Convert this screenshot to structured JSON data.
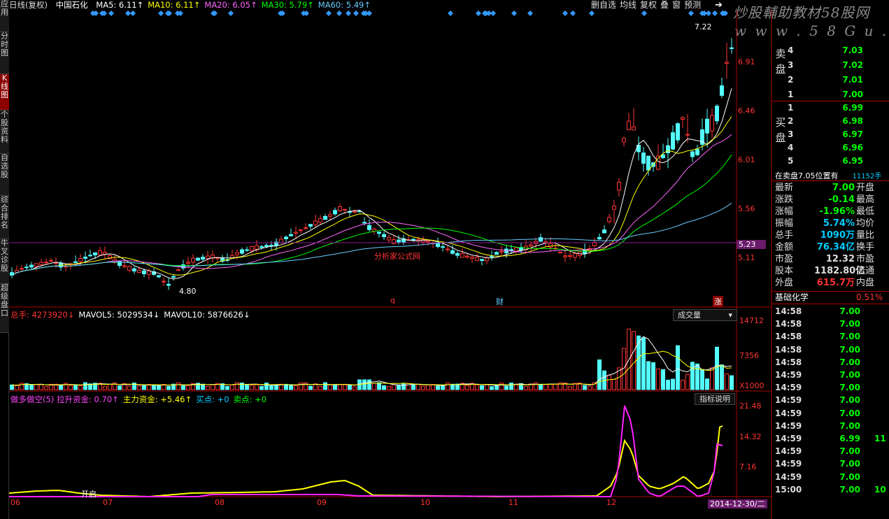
{
  "left_tabs": [
    {
      "label": "应用",
      "active": false
    },
    {
      "label": "分时图",
      "active": false
    },
    {
      "label": "K线图",
      "active": true
    },
    {
      "label": "个股资料",
      "active": false
    },
    {
      "label": "自选股",
      "active": false
    },
    {
      "label": "综合排名",
      "active": false
    },
    {
      "label": "牛叉诊股",
      "active": false
    },
    {
      "label": "超级盘口",
      "active": false
    }
  ],
  "header": {
    "period": "日线(复权)",
    "stock_name": "中国石化",
    "mas": [
      {
        "label": "MA5: 6.11↑",
        "color": "#ffffff"
      },
      {
        "label": "MA10: 6.11↑",
        "color": "#ffff00"
      },
      {
        "label": "MA20: 6.05↑",
        "color": "#ff66ff"
      },
      {
        "label": "MA30: 5.79↑",
        "color": "#00ff00"
      },
      {
        "label": "MA60: 5.49↑",
        "color": "#66ccff"
      }
    ]
  },
  "toolbar": {
    "items": [
      "删自选",
      "均线",
      "复权",
      "叠",
      "窗",
      "预测"
    ]
  },
  "watermark": {
    "line1": "炒股輔助教材58股网",
    "line2": "w w w . 5 8 G u . c o m"
  },
  "price_axis": {
    "labels": [
      "6.91",
      "6.46",
      "6.01",
      "5.56",
      "5.11"
    ],
    "current": "5.23"
  },
  "annotations": {
    "high": "7.22",
    "low": "4.80",
    "formula": "分析家公式网",
    "marker_q": "q",
    "marker_cai": "财",
    "marker_zhang": "涨"
  },
  "volume": {
    "legend": "总手: 4273920↓ MAVOL5: 5029534↓ MAVOL10: 5876626↓",
    "legend_parts": [
      {
        "text": "总手: 4273920↓",
        "color": "#ff3333"
      },
      {
        "text": "MAVOL5: 5029534↓",
        "color": "#ffffff"
      },
      {
        "text": "MAVOL10: 5876626↓",
        "color": "#ffffff"
      }
    ],
    "selector": "成交量",
    "axis": [
      "14712",
      "7356",
      "X1000"
    ]
  },
  "indicator": {
    "legend_parts": [
      {
        "text": "做多做空(5) 拉升资金: 0.70↑",
        "color": "#ff44ff"
      },
      {
        "text": "主力资金: +5.46↑",
        "color": "#ffff00"
      },
      {
        "text": "买点: +0",
        "color": "#00ccff"
      },
      {
        "text": "卖点: +0",
        "color": "#00ff00"
      }
    ],
    "button": "指标说明",
    "axis": [
      "21.48",
      "14.32",
      "7.16"
    ],
    "label_in_plot": "开启"
  },
  "x_axis": {
    "labels": [
      "06",
      "07",
      "08",
      "09",
      "10",
      "11",
      "12"
    ],
    "date_badge": "2014-12-30/二"
  },
  "order_book": {
    "sell_label": "卖盘",
    "buy_label": "买盘",
    "sell": [
      {
        "level": "4",
        "price": "7.03"
      },
      {
        "level": "3",
        "price": "7.02"
      },
      {
        "level": "2",
        "price": "7.01"
      },
      {
        "level": "1",
        "price": "7.00"
      }
    ],
    "buy": [
      {
        "level": "1",
        "price": "6.99"
      },
      {
        "level": "2",
        "price": "6.98"
      },
      {
        "level": "3",
        "price": "6.97"
      },
      {
        "level": "4",
        "price": "6.96"
      },
      {
        "level": "5",
        "price": "6.95"
      }
    ],
    "summary": "在卖盘7.05位置有",
    "summary_vol": "11152手"
  },
  "quote": [
    {
      "label": "最新",
      "value": "7.00",
      "color": "#00ff00",
      "right": "开盘"
    },
    {
      "label": "涨跌",
      "value": "-0.14",
      "color": "#00ff00",
      "right": "最高"
    },
    {
      "label": "涨幅",
      "value": "-1.96%",
      "color": "#00ff00",
      "right": "最低"
    },
    {
      "label": "振幅",
      "value": "5.74%",
      "color": "#00ccff",
      "right": "均价"
    },
    {
      "label": "总手",
      "value": "1090万",
      "color": "#00ccff",
      "right": "量比"
    },
    {
      "label": "金额",
      "value": "76.34亿",
      "color": "#00ccff",
      "right": "换手"
    },
    {
      "label": "市盈",
      "value": "12.32",
      "color": "#dddddd",
      "right": "市盈"
    },
    {
      "label": "股本",
      "value": "1182.80亿",
      "color": "#dddddd",
      "right": "流通"
    },
    {
      "label": "外盘",
      "value": "615.7万",
      "color": "#ff3333",
      "right": "内盘"
    }
  ],
  "sector": {
    "name": "基础化学",
    "change": "0.51%"
  },
  "ticks": [
    {
      "time": "14:58",
      "price": "7.00",
      "vol": ""
    },
    {
      "time": "14:58",
      "price": "7.00",
      "vol": ""
    },
    {
      "time": "14:58",
      "price": "7.00",
      "vol": ""
    },
    {
      "time": "14:58",
      "price": "7.00",
      "vol": ""
    },
    {
      "time": "14:58",
      "price": "7.00",
      "vol": ""
    },
    {
      "time": "14:59",
      "price": "7.00",
      "vol": ""
    },
    {
      "time": "14:59",
      "price": "7.00",
      "vol": ""
    },
    {
      "time": "14:59",
      "price": "7.00",
      "vol": ""
    },
    {
      "time": "14:59",
      "price": "7.00",
      "vol": ""
    },
    {
      "time": "14:59",
      "price": "7.00",
      "vol": ""
    },
    {
      "time": "14:59",
      "price": "6.99",
      "vol": "11"
    },
    {
      "time": "14:59",
      "price": "7.00",
      "vol": ""
    },
    {
      "time": "14:59",
      "price": "7.00",
      "vol": ""
    },
    {
      "time": "14:59",
      "price": "7.00",
      "vol": ""
    },
    {
      "time": "15:00",
      "price": "7.00",
      "vol": "10"
    }
  ],
  "colors": {
    "up": "#ff3333",
    "down": "#54ffff",
    "ma5": "#ffffff",
    "ma10": "#ffff00",
    "ma20": "#ff66ff",
    "ma30": "#00ff00",
    "ma60": "#66ccff"
  }
}
